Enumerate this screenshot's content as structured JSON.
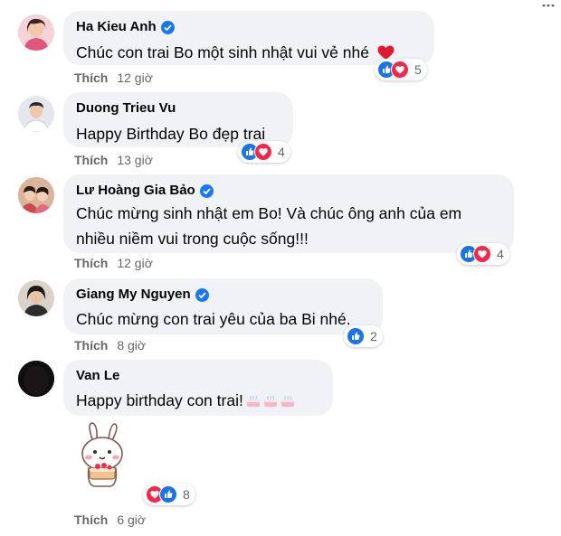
{
  "comments": [
    {
      "name": "Ha Kieu Anh",
      "verified": true,
      "text": "Chúc con trai Bo một sinh nhật vui vẻ nhé",
      "has_heart_emoji": true,
      "like_label": "Thích",
      "time": "12 giờ",
      "reactions": [
        "like-icon",
        "love-icon"
      ],
      "reaction_count": "5"
    },
    {
      "name": "Duong Trieu Vu",
      "verified": false,
      "text": "Happy Birthday Bo đẹp trai",
      "like_label": "Thích",
      "time": "13 giờ",
      "reactions": [
        "like-icon",
        "love-icon"
      ],
      "reaction_count": "4"
    },
    {
      "name": "Lư Hoàng Gia Bảo",
      "verified": true,
      "text_line1": "Chúc mừng sinh nhật em Bo! Và chúc ông anh của em",
      "text_line2": "nhiều niềm vui trong cuộc sống!!!",
      "like_label": "Thích",
      "time": "12 giờ",
      "reactions": [
        "like-icon",
        "love-icon"
      ],
      "reaction_count": "4"
    },
    {
      "name": "Giang My Nguyen",
      "verified": true,
      "text": "Chúc mừng con trai yêu của ba Bi nhé.",
      "like_label": "Thích",
      "time": "8 giờ",
      "reactions": [
        "like-icon"
      ],
      "reaction_count": "2"
    },
    {
      "name": "Van Le",
      "verified": false,
      "text": "Happy birthday con trai!",
      "cake_emojis": 3,
      "sticker": "bunny-cake-sticker",
      "like_label": "Thích",
      "time": "6 giờ",
      "reactions": [
        "love-icon",
        "like-icon"
      ],
      "reaction_count": "8"
    }
  ],
  "colors": {
    "bubble": "#f0f2f5",
    "like_blue": "#1b74e4",
    "love_red": "#f0284a",
    "verified_blue": "#1877f2",
    "meta_gray": "#65676b"
  }
}
